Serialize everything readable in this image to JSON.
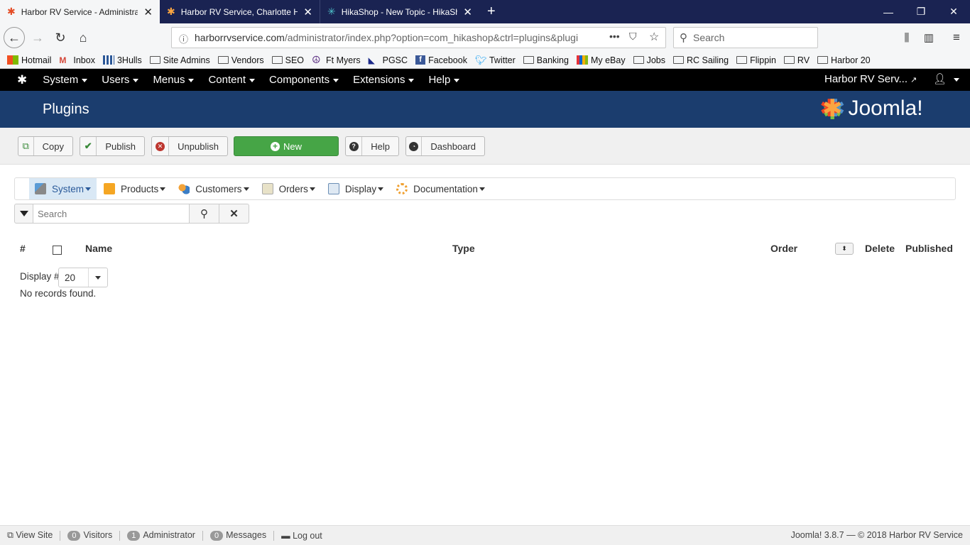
{
  "browser": {
    "tabs": [
      {
        "title": "Harbor RV Service - Administra",
        "active": true
      },
      {
        "title": "Harbor RV Service, Charlotte H",
        "active": false
      },
      {
        "title": "HikaShop - New Topic - HikaSh",
        "active": false
      }
    ],
    "url_host": "harborrvservice.com",
    "url_path": "/administrator/index.php?option=com_hikashop&ctrl=plugins&plugi",
    "search_placeholder": "Search",
    "bookmarks": [
      "Hotmail",
      "Inbox",
      "3Hulls",
      "Site Admins",
      "Vendors",
      "SEO",
      "Ft Myers",
      "PGSC",
      "Facebook",
      "Twitter",
      "Banking",
      "My eBay",
      "Jobs",
      "RC Sailing",
      "Flippin",
      "RV",
      "Harbor 20"
    ]
  },
  "joomla": {
    "menu": [
      "System",
      "Users",
      "Menus",
      "Content",
      "Components",
      "Extensions",
      "Help"
    ],
    "site_link": "Harbor RV Serv...",
    "page_title": "Plugins",
    "logo_text": "Joomla!"
  },
  "toolbar": {
    "copy": "Copy",
    "publish": "Publish",
    "unpublish": "Unpublish",
    "new": "New",
    "help": "Help",
    "dashboard": "Dashboard"
  },
  "hikamenu": [
    "System",
    "Products",
    "Customers",
    "Orders",
    "Display",
    "Documentation"
  ],
  "filter": {
    "search_placeholder": "Search"
  },
  "table": {
    "headers": {
      "num": "#",
      "name": "Name",
      "type": "Type",
      "order": "Order",
      "delete": "Delete",
      "published": "Published"
    },
    "display_label": "Display #",
    "display_value": "20",
    "empty": "No records found."
  },
  "footer": {
    "view_site": "View Site",
    "visitors_count": "0",
    "visitors": "Visitors",
    "admin_count": "1",
    "admin": "Administrator",
    "messages_count": "0",
    "messages": "Messages",
    "logout": "Log out",
    "version": "Joomla! 3.8.7 — © 2018 Harbor RV Service"
  },
  "colors": {
    "joomla_blue": "#1b3d6e",
    "new_green": "#46a546",
    "tabbar": "#1a2352"
  }
}
